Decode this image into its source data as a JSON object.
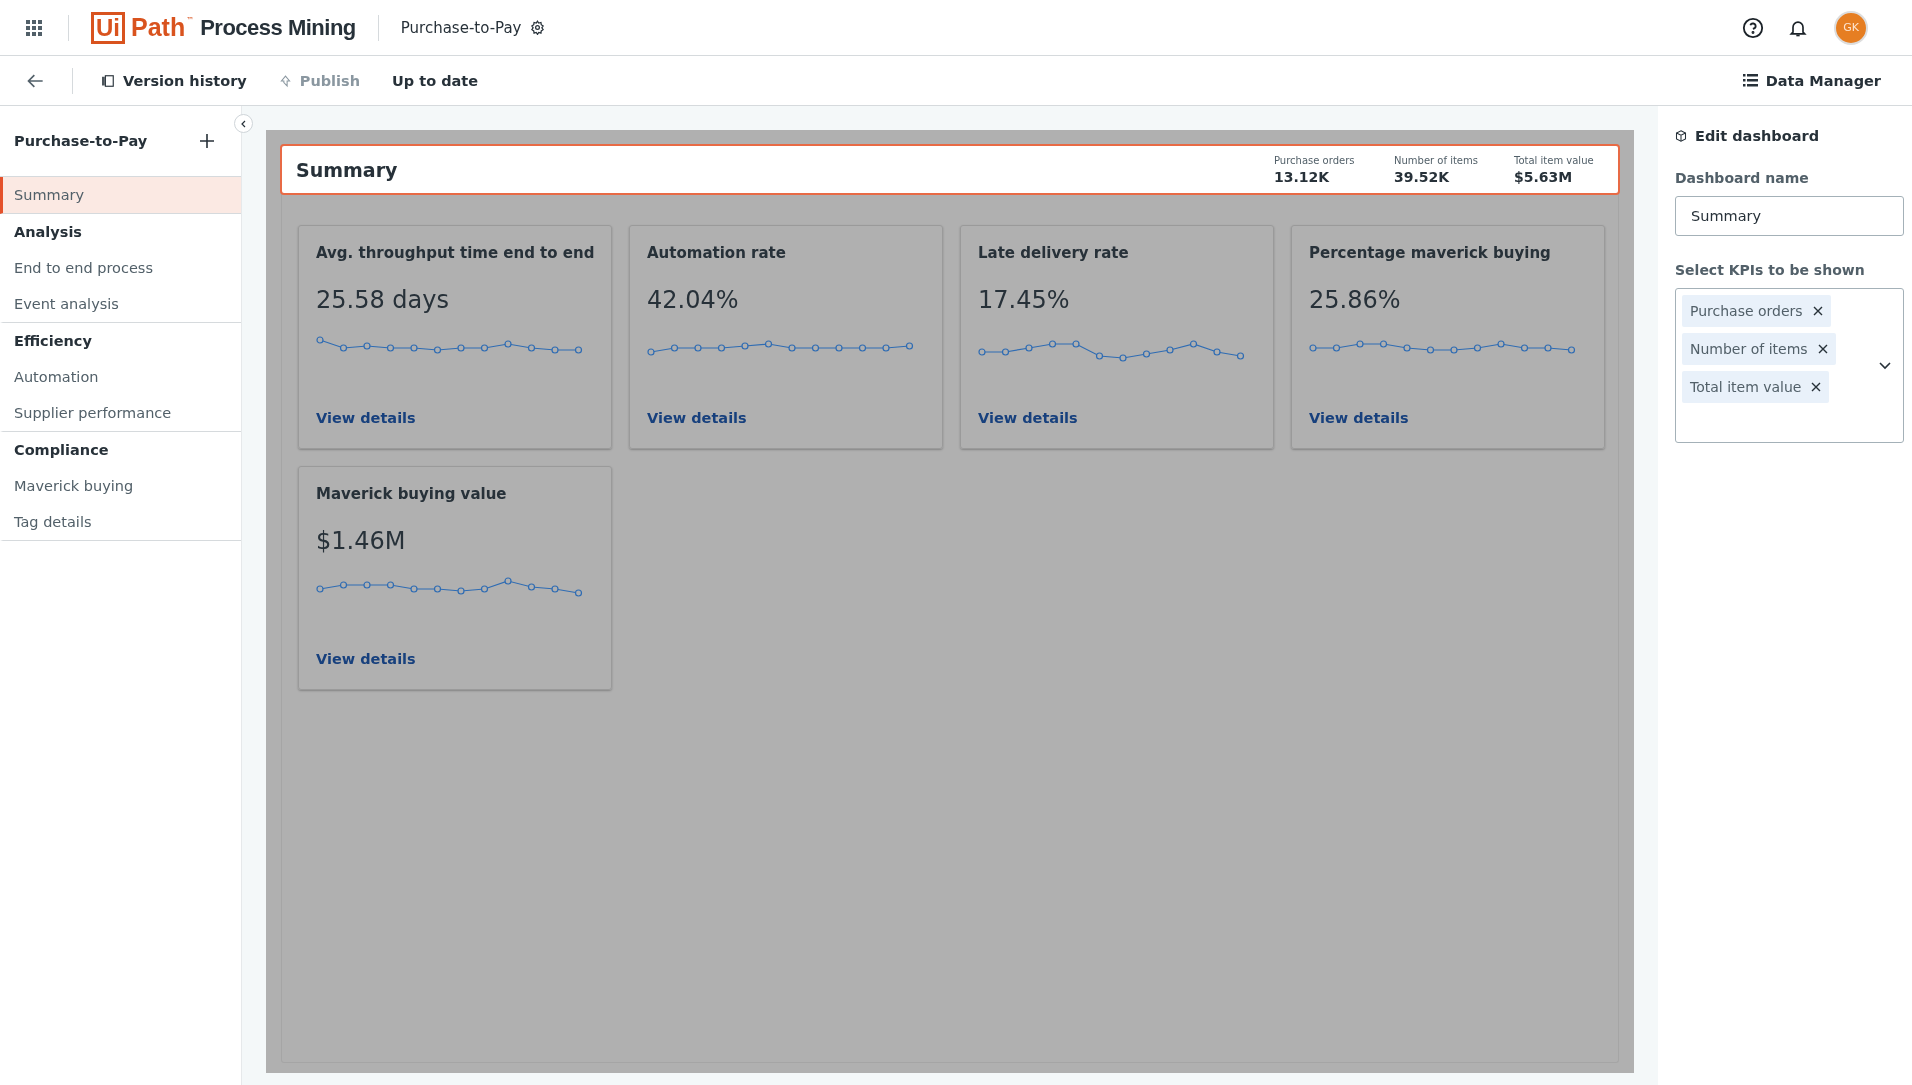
{
  "app_bar": {
    "logo": {
      "box": "Ui",
      "word": "Path",
      "mark": "™",
      "product": "Process Mining"
    },
    "process": "Purchase-to-Pay",
    "avatar": "GK"
  },
  "toolbar": {
    "items": [
      {
        "kind": "history",
        "label": "Version history",
        "disabled": false
      },
      {
        "kind": "publish",
        "label": "Publish",
        "disabled": true
      },
      {
        "kind": "status",
        "label": "Up to date",
        "disabled": false
      }
    ],
    "data_manager": "Data Manager"
  },
  "sidebar": {
    "title": "Purchase-to-Pay",
    "items": [
      {
        "kind": "page",
        "label": "Summary",
        "selected": true,
        "divider": true
      },
      {
        "kind": "group",
        "label": "Analysis",
        "selected": false,
        "divider": false
      },
      {
        "kind": "page",
        "label": "End to end process",
        "selected": false,
        "divider": false
      },
      {
        "kind": "page",
        "label": "Event analysis",
        "selected": false,
        "divider": true
      },
      {
        "kind": "group",
        "label": "Efficiency",
        "selected": false,
        "divider": false
      },
      {
        "kind": "page",
        "label": "Automation",
        "selected": false,
        "divider": false
      },
      {
        "kind": "page",
        "label": "Supplier performance",
        "selected": false,
        "divider": true
      },
      {
        "kind": "group",
        "label": "Compliance",
        "selected": false,
        "divider": false
      },
      {
        "kind": "page",
        "label": "Maverick buying",
        "selected": false,
        "divider": false
      },
      {
        "kind": "page",
        "label": "Tag details",
        "selected": false,
        "divider": true
      }
    ]
  },
  "summary": {
    "title": "Summary",
    "kpis": [
      {
        "label": "Purchase orders",
        "value": "13.12K"
      },
      {
        "label": "Number of items",
        "value": "39.52K"
      },
      {
        "label": "Total item value",
        "value": "$5.63M"
      }
    ]
  },
  "cards": [
    {
      "title": "Avg. throughput time end to end",
      "value": "25.58 days",
      "link": "View details"
    },
    {
      "title": "Automation rate",
      "value": "42.04%",
      "link": "View details"
    },
    {
      "title": "Late delivery rate",
      "value": "17.45%",
      "link": "View details"
    },
    {
      "title": "Percentage maverick buying",
      "value": "25.86%",
      "link": "View details"
    },
    {
      "title": "Maverick buying value",
      "value": "$1.46M",
      "link": "View details"
    }
  ],
  "edit_panel": {
    "title": "Edit dashboard",
    "name_label": "Dashboard name",
    "name_value": "Summary",
    "kpi_label": "Select KPIs to be shown",
    "chips": [
      "Purchase orders",
      "Number of items",
      "Total item value"
    ]
  }
}
